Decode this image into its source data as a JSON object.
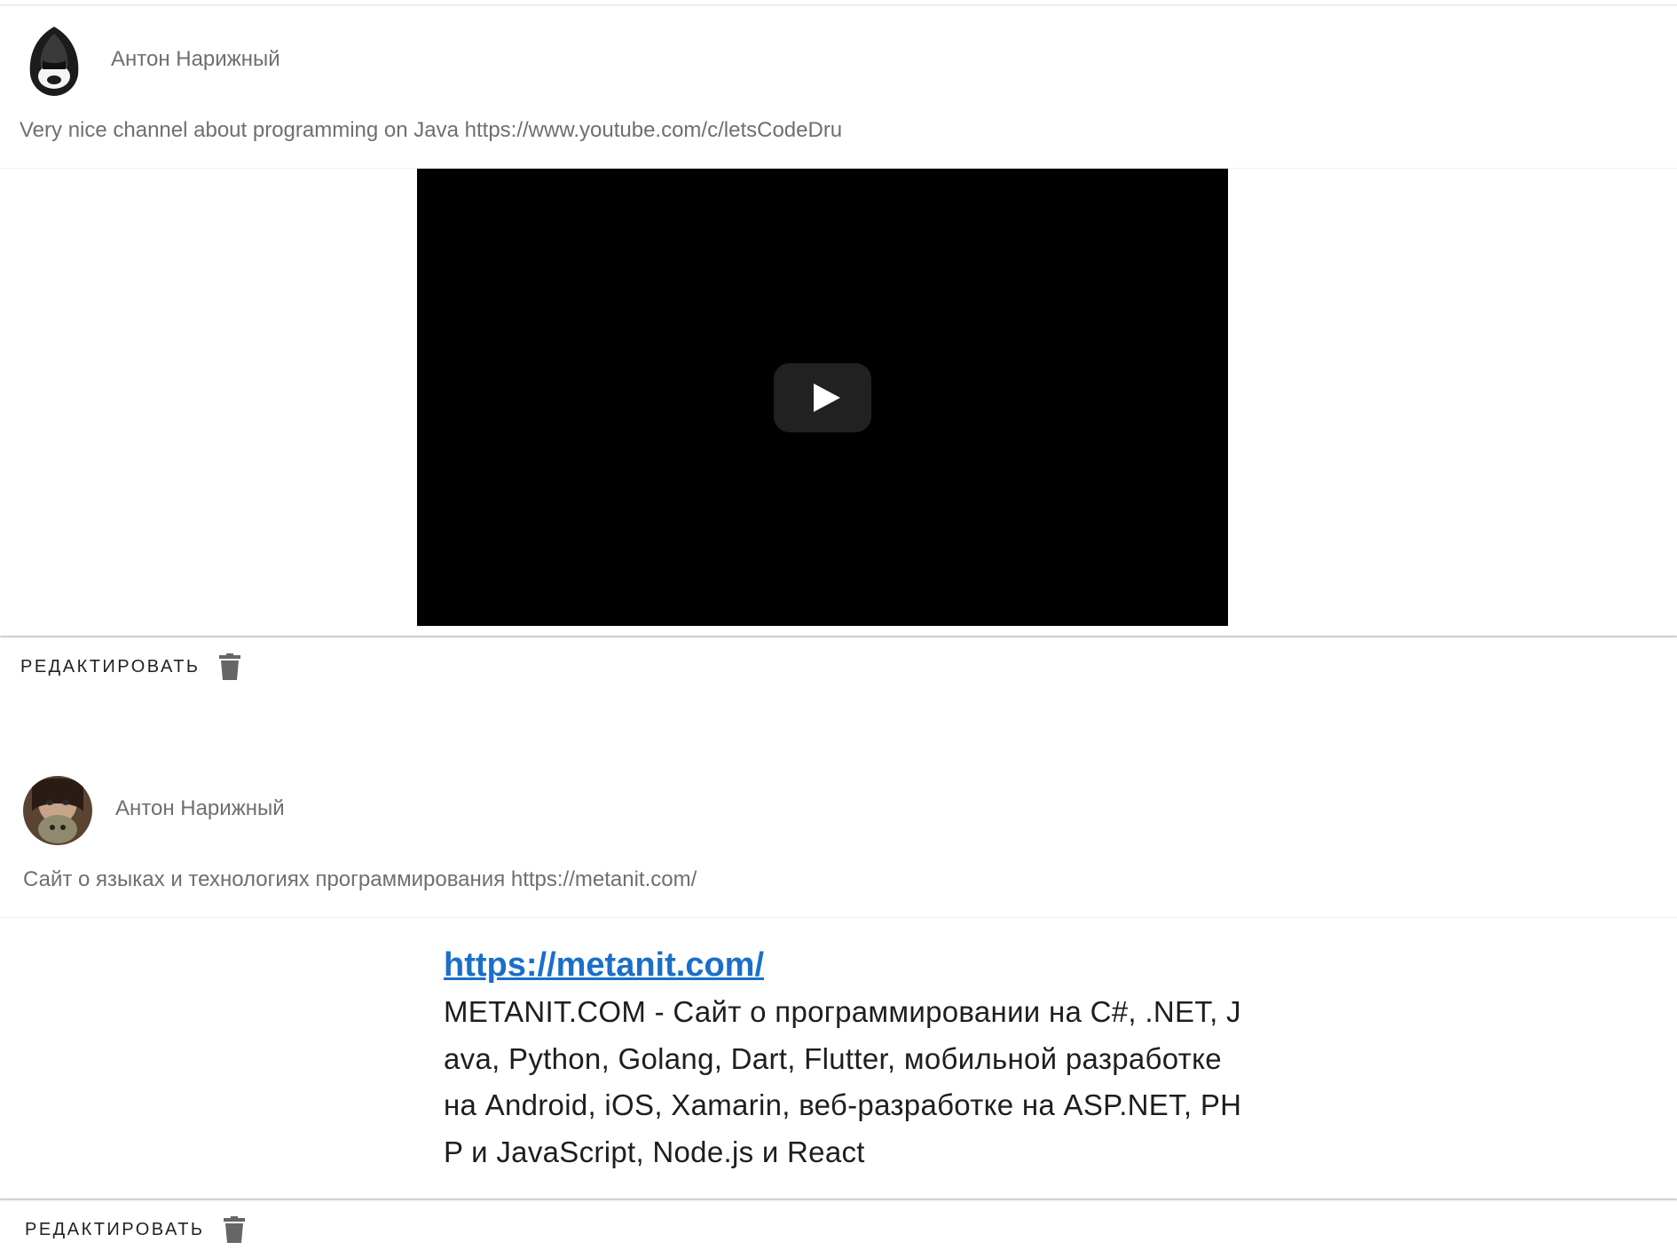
{
  "posts": [
    {
      "author": "Антон Нарижный",
      "avatar_icon": "hooded-figure-avatar",
      "text": "Very nice channel about programming on Java https://www.youtube.com/c/letsCodeDru",
      "media": {
        "type": "video",
        "play_icon": "play-icon"
      },
      "actions": {
        "edit_label": "РЕДАКТИРОВАТЬ",
        "delete_icon": "trash-icon"
      }
    },
    {
      "author": "Антон Нарижный",
      "avatar_icon": "photo-avatar",
      "text": "Сайт о языках и технологиях программирования https://metanit.com/",
      "media": {
        "type": "link-preview",
        "url": "https://metanit.com/",
        "description": "METANIT.COM - Сайт о программировании на C#, .NET, Java, Python, Golang, Dart, Flutter, мобильной разработке на Android, iOS, Xamarin, веб-разработке на ASP.NET, PHP и JavaScript, Node.js и React"
      },
      "actions": {
        "edit_label": "РЕДАКТИРОВАТЬ",
        "delete_icon": "trash-icon"
      }
    }
  ],
  "colors": {
    "link": "#1a6fc9",
    "muted_text": "#6f6f6f",
    "video_bg": "#000000"
  }
}
